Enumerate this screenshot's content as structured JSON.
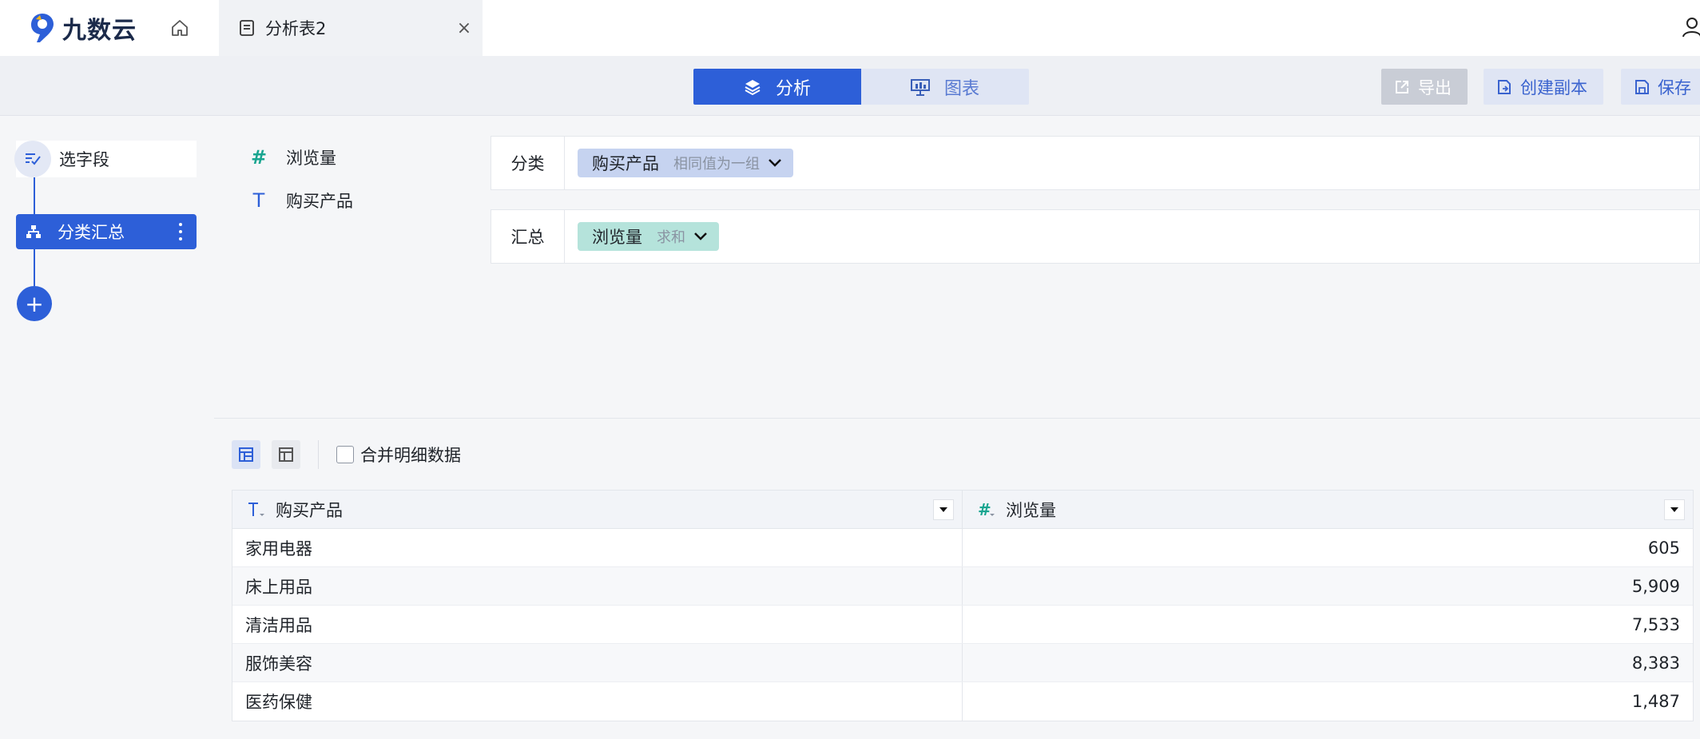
{
  "app": {
    "name": "九数云"
  },
  "tab": {
    "label": "分析表2",
    "close": "×"
  },
  "toolbar": {
    "analysis_label": "分析",
    "chart_label": "图表",
    "export_label": "导出",
    "copy_label": "创建副本",
    "save_label": "保存"
  },
  "steps": {
    "select_label": "选字段",
    "group_label": "分类汇总",
    "add_label": "+"
  },
  "fields": [
    {
      "type": "number",
      "icon": "#",
      "label": "浏览量"
    },
    {
      "type": "text",
      "icon": "T",
      "label": "购买产品"
    }
  ],
  "config": {
    "category": {
      "label": "分类",
      "chip": "购买产品",
      "chip_sub": "相同值为一组"
    },
    "summary": {
      "label": "汇总",
      "chip": "浏览量",
      "chip_sub": "求和"
    }
  },
  "result": {
    "merge_label": "合并明细数据",
    "columns": [
      {
        "type": "text",
        "label": "购买产品"
      },
      {
        "type": "number",
        "label": "浏览量"
      }
    ],
    "rows": [
      {
        "product": "家用电器",
        "views": "605"
      },
      {
        "product": "床上用品",
        "views": "5,909"
      },
      {
        "product": "清洁用品",
        "views": "7,533"
      },
      {
        "product": "服饰美容",
        "views": "8,383"
      },
      {
        "product": "医药保健",
        "views": "1,487"
      }
    ]
  },
  "colors": {
    "primary": "#2d5fd8",
    "dimension_chip": "#c6d3f0",
    "measure_chip": "#b5e3db",
    "number_icon": "#19a590"
  }
}
